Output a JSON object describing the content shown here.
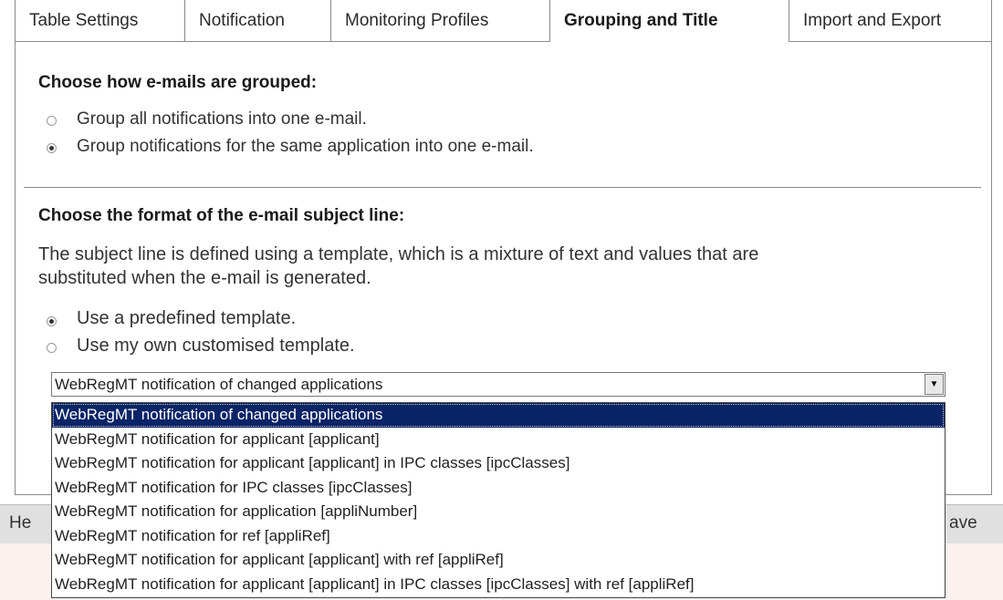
{
  "tabs": [
    {
      "label": "Table Settings"
    },
    {
      "label": "Notification"
    },
    {
      "label": "Monitoring Profiles"
    },
    {
      "label": "Grouping and Title"
    },
    {
      "label": "Import and Export"
    }
  ],
  "grouping": {
    "heading": "Choose how e-mails are grouped:",
    "options": [
      {
        "label": "Group all notifications into one e-mail.",
        "selected": false
      },
      {
        "label": "Group notifications for the same application into one e-mail.",
        "selected": true
      }
    ]
  },
  "subject": {
    "heading": "Choose the format of the e-mail subject line:",
    "description_line1": "The subject line is defined using a template, which is a mixture of text and values that are",
    "description_line2": "substituted when the e-mail is generated.",
    "options": [
      {
        "label": "Use a predefined template.",
        "selected": true
      },
      {
        "label": "Use my own customised template.",
        "selected": false
      }
    ],
    "select_value": "WebRegMT notification of changed applications",
    "dropdown_options": [
      "WebRegMT notification of changed applications",
      "WebRegMT notification for applicant [applicant]",
      "WebRegMT notification for applicant [applicant] in IPC classes [ipcClasses]",
      "WebRegMT notification for IPC classes [ipcClasses]",
      "WebRegMT notification for application [appliNumber]",
      "WebRegMT notification for ref [appliRef]",
      "WebRegMT notification for applicant [applicant] with ref [appliRef]",
      "WebRegMT notification for applicant [applicant] in IPC classes [ipcClasses] with ref [appliRef]"
    ]
  },
  "buttons": {
    "left_partial": "He",
    "right_partial": "ave"
  }
}
